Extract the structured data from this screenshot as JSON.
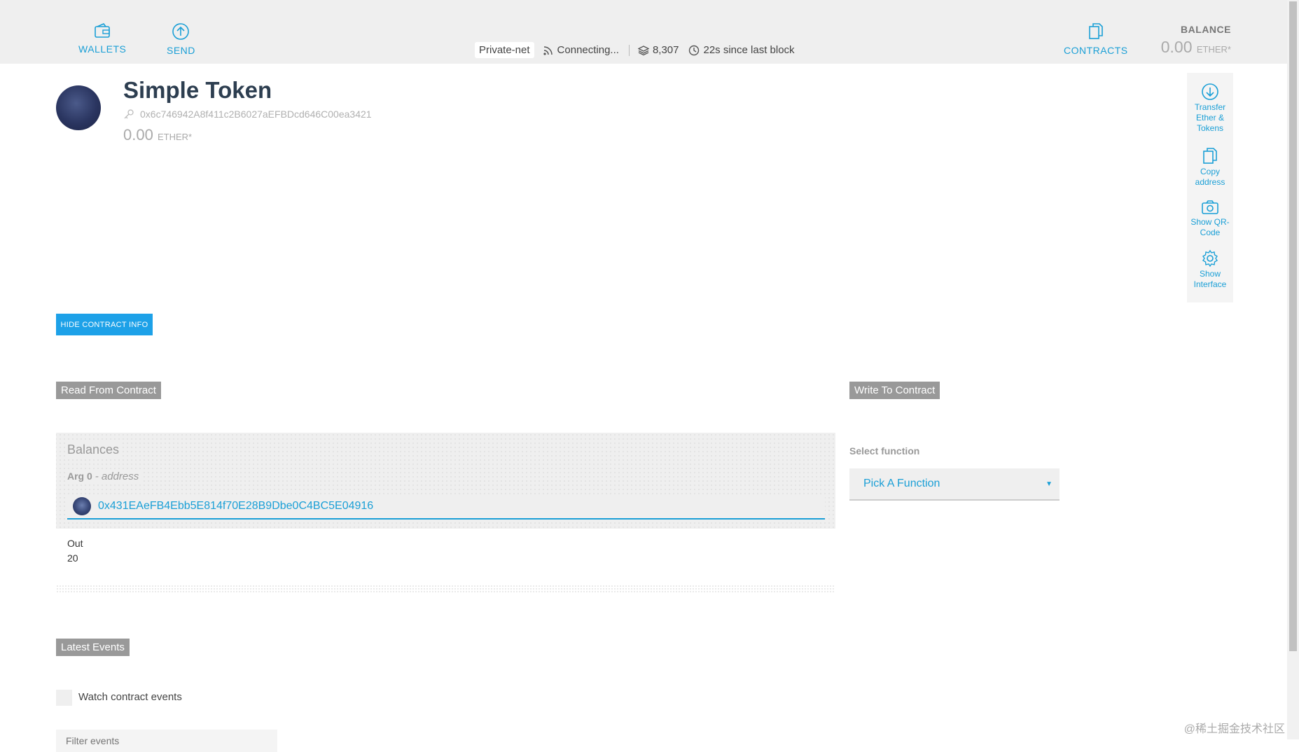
{
  "header": {
    "wallets_label": "WALLETS",
    "send_label": "SEND",
    "contracts_label": "CONTRACTS",
    "network": "Private-net",
    "peers": "Connecting...",
    "block": "8,307",
    "since_block": "22s since last block",
    "balance_label": "BALANCE",
    "balance_value": "0.00",
    "balance_unit": "ETHER*"
  },
  "account": {
    "title": "Simple Token",
    "address": "0x6c746942A8f411c2B6027aEFBDcd646C00ea3421",
    "balance_value": "0.00",
    "balance_unit": "ETHER*"
  },
  "side_actions": {
    "transfer": [
      "Transfer",
      "Ether &",
      "Tokens"
    ],
    "copy": [
      "Copy",
      "address"
    ],
    "qr": [
      "Show QR-",
      "Code"
    ],
    "interface": [
      "Show",
      "Interface"
    ]
  },
  "contract": {
    "hide_info_label": "HIDE CONTRACT INFO",
    "read_title": "Read From Contract",
    "write_title": "Write To Contract",
    "balances": {
      "title": "Balances",
      "arg_label": "Arg 0",
      "arg_type": "- address",
      "arg_value": "0x431EAeFB4Ebb5E814f70E28B9Dbe0C4BC5E04916",
      "out_label": "Out",
      "out_value": "20"
    },
    "select_function_label": "Select function",
    "select_function_value": "Pick A Function",
    "select_caret": "▼"
  },
  "events": {
    "title": "Latest Events",
    "watch_label": "Watch contract events",
    "filter_placeholder": "Filter events"
  },
  "watermark": "@稀土掘金技术社区"
}
